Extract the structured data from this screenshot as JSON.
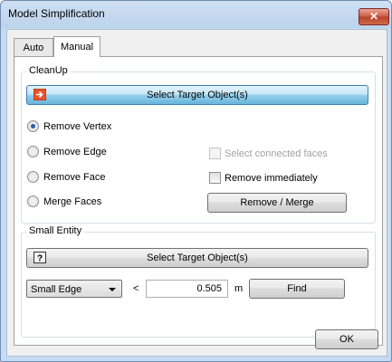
{
  "window": {
    "title": "Model Simplification",
    "close_glyph": "✕"
  },
  "tabs": [
    {
      "label": "Auto"
    },
    {
      "label": "Manual"
    }
  ],
  "cleanup": {
    "group_label": "CleanUp",
    "select_target_label": "Select Target Object(s)",
    "radios": [
      {
        "label": "Remove Vertex",
        "selected": true
      },
      {
        "label": "Remove Edge",
        "selected": false
      },
      {
        "label": "Remove Face",
        "selected": false
      },
      {
        "label": "Merge Faces",
        "selected": false
      }
    ],
    "select_connected_label": "Select connected faces",
    "remove_immediately_label": "Remove immediately",
    "remove_merge_label": "Remove / Merge"
  },
  "small_entity": {
    "group_label": "Small Entity",
    "select_target_label": "Select Target Object(s)",
    "type_selected": "Small Edge",
    "comparator": "<",
    "value": "0.505",
    "unit": "m",
    "find_label": "Find"
  },
  "footer": {
    "ok_label": "OK"
  }
}
